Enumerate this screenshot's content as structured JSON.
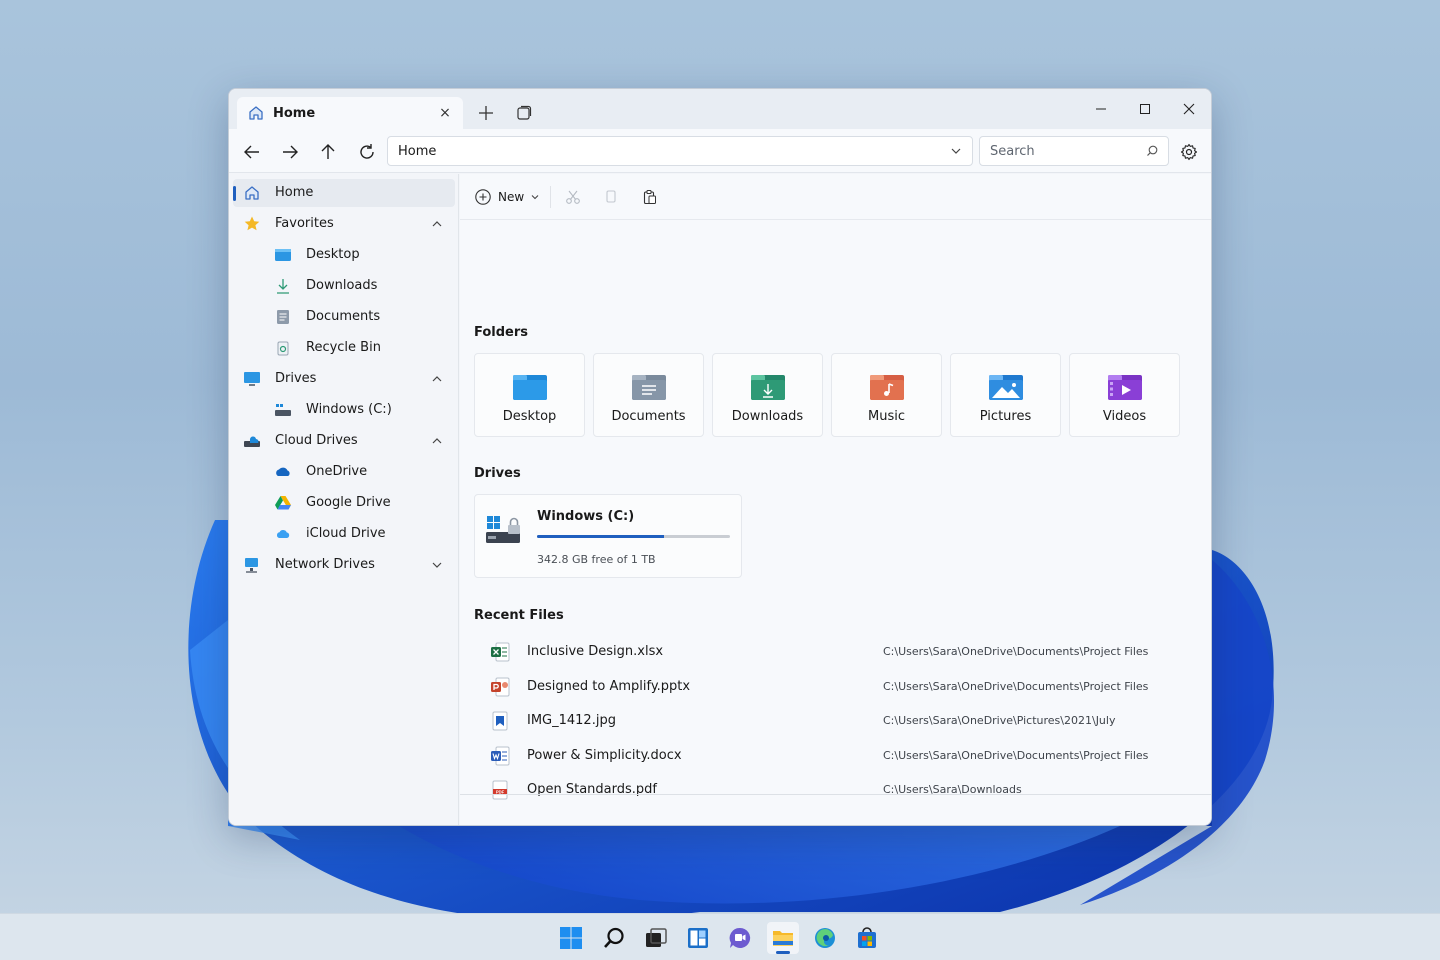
{
  "window": {
    "tab_title": "Home",
    "tab_close": "×",
    "new_tab": "+",
    "minimize": "—",
    "maximize": "☐",
    "close": "✕"
  },
  "navbar": {
    "address": "Home",
    "search_placeholder": "Search"
  },
  "sidebar": {
    "items": [
      {
        "label": "Home",
        "icon": "home-icon",
        "active": true
      },
      {
        "label": "Favorites",
        "icon": "star-icon",
        "expanded": true
      },
      {
        "label": "Desktop",
        "icon": "desktop-folder-icon"
      },
      {
        "label": "Downloads",
        "icon": "download-icon"
      },
      {
        "label": "Documents",
        "icon": "document-icon"
      },
      {
        "label": "Recycle Bin",
        "icon": "recycle-bin-icon"
      },
      {
        "label": "Drives",
        "icon": "monitor-icon",
        "expanded": true
      },
      {
        "label": "Windows (C:)",
        "icon": "drive-icon"
      },
      {
        "label": "Cloud Drives",
        "icon": "cloud-drives-icon",
        "expanded": true
      },
      {
        "label": "OneDrive",
        "icon": "onedrive-icon"
      },
      {
        "label": "Google Drive",
        "icon": "google-drive-icon"
      },
      {
        "label": "iCloud Drive",
        "icon": "icloud-icon"
      },
      {
        "label": "Network Drives",
        "icon": "network-drive-icon",
        "expanded": false
      }
    ]
  },
  "toolbar": {
    "new_label": "New",
    "more": "···"
  },
  "folders": {
    "title": "Folders",
    "items": [
      {
        "label": "Desktop",
        "icon": "desktop-folder-icon",
        "color": "#1e88d8"
      },
      {
        "label": "Documents",
        "icon": "documents-folder-icon",
        "color": "#6f8296"
      },
      {
        "label": "Downloads",
        "icon": "downloads-folder-icon",
        "color": "#2e9a76"
      },
      {
        "label": "Music",
        "icon": "music-folder-icon",
        "color": "#e06a4e"
      },
      {
        "label": "Pictures",
        "icon": "pictures-folder-icon",
        "color": "#2f8de0"
      },
      {
        "label": "Videos",
        "icon": "videos-folder-icon",
        "color": "#8a3fd6"
      }
    ]
  },
  "drives": {
    "title": "Drives",
    "more": "···",
    "items": [
      {
        "name": "Windows (C:)",
        "free_text": "342.8 GB free of 1 TB",
        "used_fraction": 0.66
      }
    ]
  },
  "recent": {
    "title": "Recent Files",
    "files": [
      {
        "name": "Inclusive Design.xlsx",
        "path": "C:\\Users\\Sara\\OneDrive\\Documents\\Project Files",
        "icon": "excel-icon",
        "color": "#1d7044"
      },
      {
        "name": "Designed to Amplify.pptx",
        "path": "C:\\Users\\Sara\\OneDrive\\Documents\\Project Files",
        "icon": "powerpoint-icon",
        "color": "#c4432b"
      },
      {
        "name": "IMG_1412.jpg",
        "path": "C:\\Users\\Sara\\OneDrive\\Pictures\\2021\\July",
        "icon": "image-file-icon",
        "color": "#1f5fbf"
      },
      {
        "name": "Power & Simplicity.docx",
        "path": "C:\\Users\\Sara\\OneDrive\\Documents\\Project Files",
        "icon": "word-icon",
        "color": "#2b5cb8"
      },
      {
        "name": "Open Standards.pdf",
        "path": "C:\\Users\\Sara\\Downloads",
        "icon": "pdf-icon",
        "color": "#d33a2c"
      }
    ]
  },
  "taskbar": {
    "apps": [
      "windows-start-icon",
      "search-icon",
      "task-view-icon",
      "widgets-icon",
      "chat-icon",
      "file-explorer-icon",
      "edge-icon",
      "store-icon"
    ]
  },
  "colors": {
    "accent": "#1f5fbf",
    "window_bg": "#f7f9fc",
    "sidebar_bg": "#f3f5f9"
  }
}
